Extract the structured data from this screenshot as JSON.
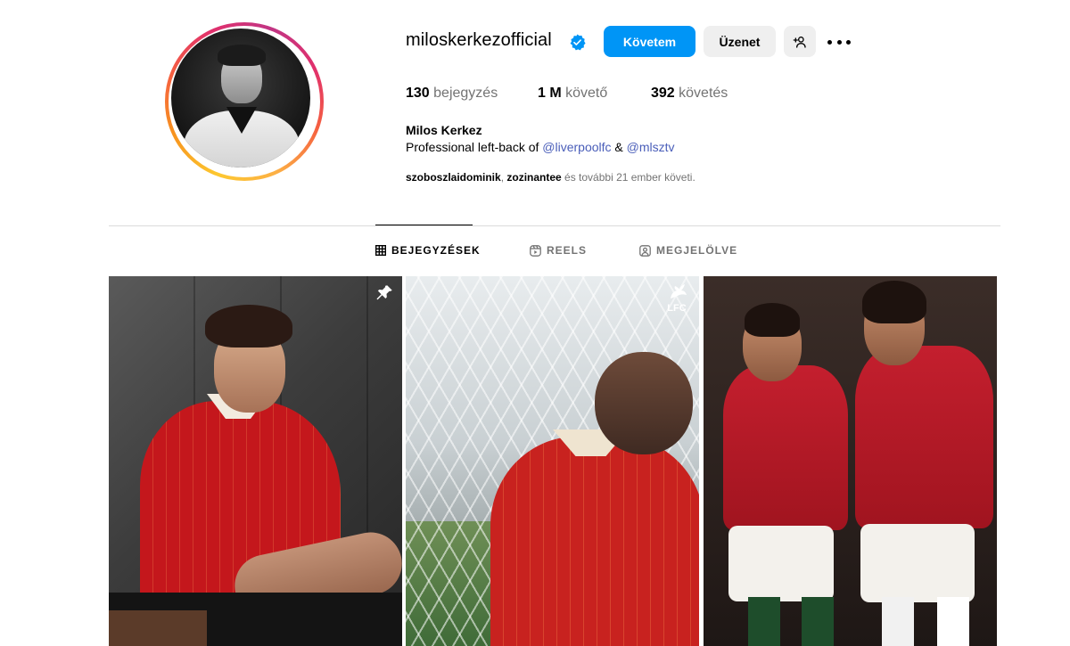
{
  "profile": {
    "username": "miloskerkezofficial",
    "verified": true,
    "full_name": "Milos Kerkez",
    "bio_prefix": "Professional left-back of ",
    "bio_link1": "@liverpoolfc",
    "bio_and": " & ",
    "bio_link2": "@mlsztv",
    "followed_by_1": "szoboszlaidominik",
    "followed_sep": ", ",
    "followed_by_2": "zozinantee",
    "followed_suffix": " és további 21 ember követi."
  },
  "actions": {
    "follow_label": "Követem",
    "message_label": "Üzenet",
    "suggest_icon": "person-add-icon",
    "more_icon": "more-options-icon"
  },
  "stats": {
    "posts_count": "130",
    "posts_label": "bejegyzés",
    "followers_count": "1 M",
    "followers_label": "követő",
    "following_count": "392",
    "following_label": "követés"
  },
  "tabs": [
    {
      "label": "BEJEGYZÉSEK",
      "icon": "grid-icon",
      "active": true
    },
    {
      "label": "REELS",
      "icon": "reels-icon",
      "active": false
    },
    {
      "label": "MEGJELÖLVE",
      "icon": "tagged-icon",
      "active": false
    }
  ],
  "posts": [
    {
      "pinned": true,
      "icon": "pin-icon"
    },
    {
      "badge": "LFC"
    },
    {}
  ],
  "colors": {
    "accent": "#0095f6",
    "secondary_button": "#efefef",
    "muted_text": "#737373",
    "link": "#4a5eb9",
    "divider": "#dbdbdb"
  }
}
